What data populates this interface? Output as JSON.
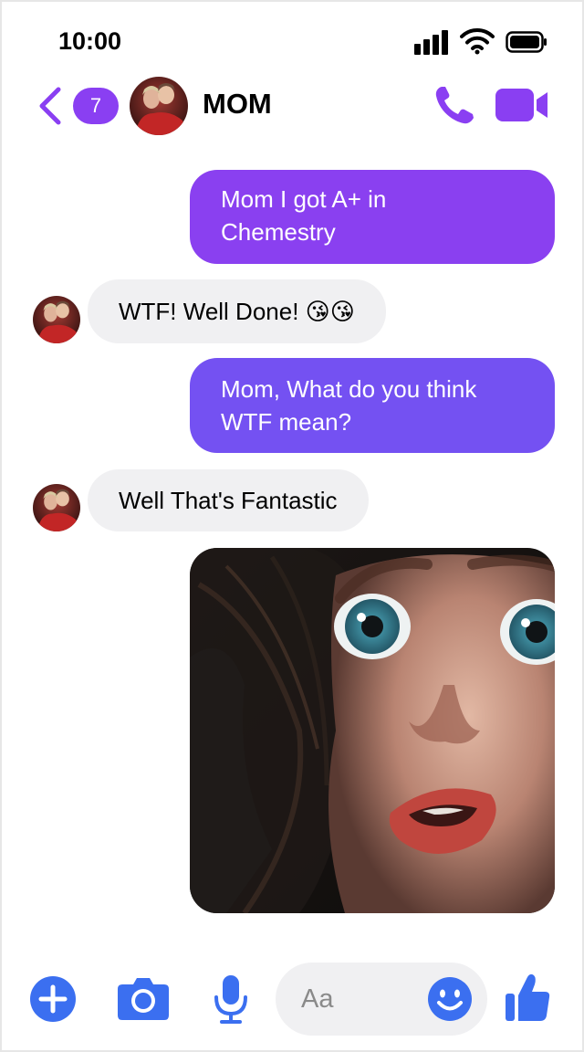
{
  "status_bar": {
    "time": "10:00"
  },
  "header": {
    "unread_count": "7",
    "contact_name": "MOM"
  },
  "messages": [
    {
      "direction": "outgoing",
      "lines": [
        "Mom I got A+ in",
        "Chemestry"
      ]
    },
    {
      "direction": "incoming",
      "text": "WTF! Well Done! 😘😘"
    },
    {
      "direction": "outgoing",
      "lines": [
        "Mom, What do you think",
        "WTF mean?"
      ]
    },
    {
      "direction": "incoming",
      "text": "Well That's Fantastic"
    },
    {
      "direction": "outgoing",
      "type": "image",
      "description": "shocked face photo"
    }
  ],
  "composer": {
    "placeholder": "Aa",
    "icons": [
      "plus-icon",
      "camera-icon",
      "microphone-icon",
      "emoji-icon",
      "thumbs-up-icon"
    ]
  },
  "colors": {
    "accent": "#8a3ff2",
    "outgoing_bubble": "#7d4af1",
    "incoming_bubble": "#f0f0f2",
    "composer_icons": "#3b6ff0"
  }
}
